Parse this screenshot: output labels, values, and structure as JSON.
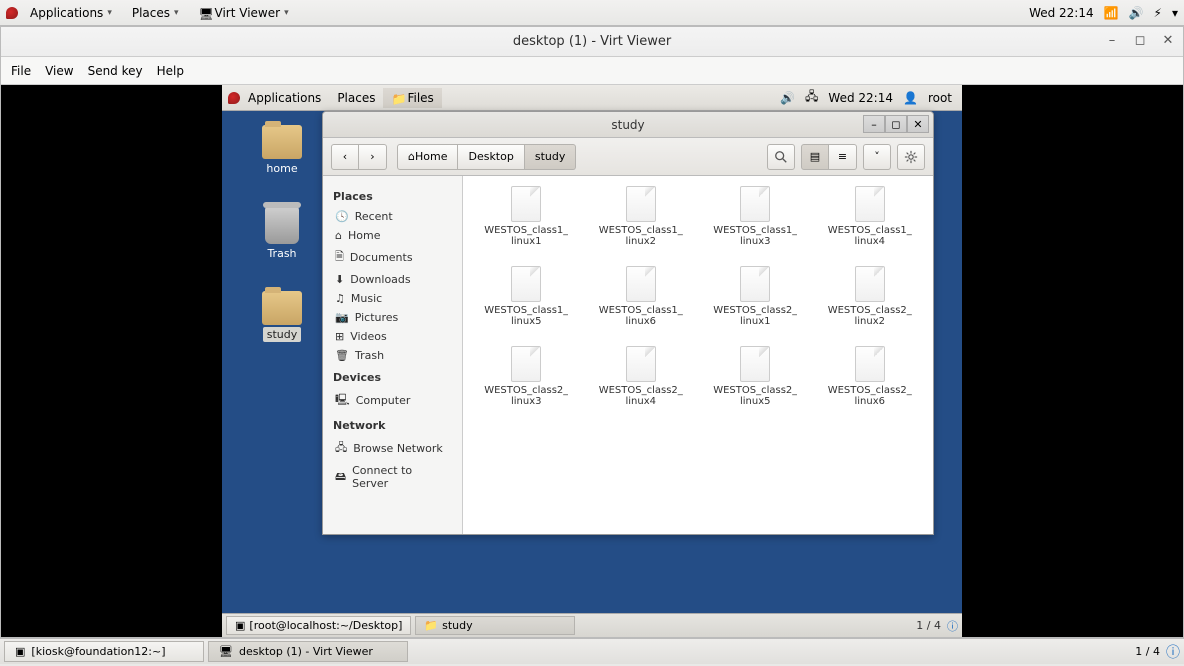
{
  "host_panel": {
    "applications": "Applications",
    "places": "Places",
    "app_running": "Virt Viewer",
    "clock": "Wed 22:14"
  },
  "virt": {
    "title": "desktop (1) - Virt Viewer",
    "menu": {
      "file": "File",
      "view": "View",
      "sendkey": "Send key",
      "help": "Help"
    }
  },
  "guest_panel": {
    "applications": "Applications",
    "places": "Places",
    "files": "Files",
    "clock": "Wed 22:14",
    "user": "root"
  },
  "desktop": {
    "home": "home",
    "trash": "Trash",
    "study": "study"
  },
  "fm": {
    "title": "study",
    "breadcrumb": {
      "home": "Home",
      "desktop": "Desktop",
      "study": "study"
    },
    "sidebar": {
      "places_hdr": "Places",
      "recent": "Recent",
      "home": "Home",
      "documents": "Documents",
      "downloads": "Downloads",
      "music": "Music",
      "pictures": "Pictures",
      "videos": "Videos",
      "trash": "Trash",
      "devices_hdr": "Devices",
      "computer": "Computer",
      "network_hdr": "Network",
      "browse": "Browse Network",
      "connect": "Connect to Server"
    },
    "files": [
      {
        "l1": "WESTOS_class1_",
        "l2": "linux1"
      },
      {
        "l1": "WESTOS_class1_",
        "l2": "linux2"
      },
      {
        "l1": "WESTOS_class1_",
        "l2": "linux3"
      },
      {
        "l1": "WESTOS_class1_",
        "l2": "linux4"
      },
      {
        "l1": "WESTOS_class1_",
        "l2": "linux5"
      },
      {
        "l1": "WESTOS_class1_",
        "l2": "linux6"
      },
      {
        "l1": "WESTOS_class2_",
        "l2": "linux1"
      },
      {
        "l1": "WESTOS_class2_",
        "l2": "linux2"
      },
      {
        "l1": "WESTOS_class2_",
        "l2": "linux3"
      },
      {
        "l1": "WESTOS_class2_",
        "l2": "linux4"
      },
      {
        "l1": "WESTOS_class2_",
        "l2": "linux5"
      },
      {
        "l1": "WESTOS_class2_",
        "l2": "linux6"
      }
    ]
  },
  "guest_taskbar": {
    "terminal": "[root@localhost:~/Desktop]",
    "fm": "study",
    "pager": "1 / 4"
  },
  "host_taskbar": {
    "terminal": "[kiosk@foundation12:~]",
    "virt": "desktop (1) - Virt Viewer",
    "pager": "1 / 4"
  }
}
